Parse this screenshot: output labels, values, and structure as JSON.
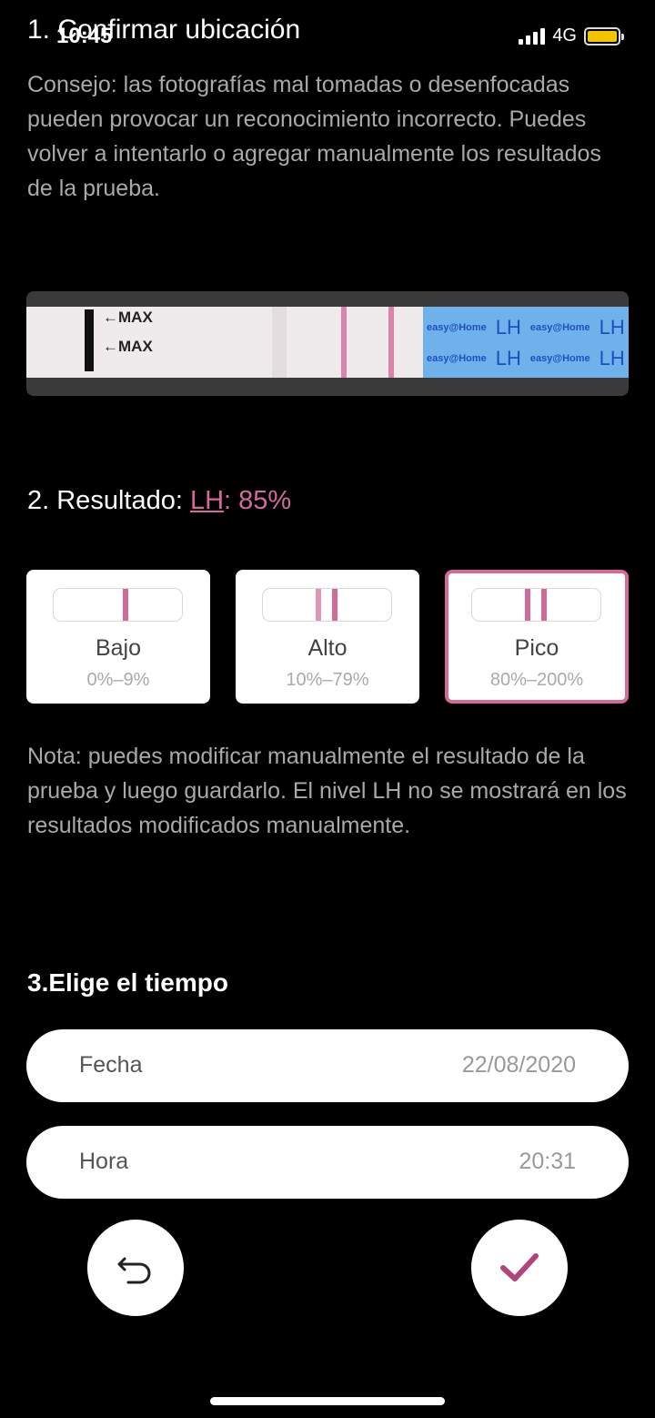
{
  "status_bar": {
    "time": "10:45",
    "network": "4G"
  },
  "section1": {
    "title": "1. Confirmar ubicación",
    "tip": "Consejo: las fotografías mal tomadas o desenfocadas pueden provocar un reconocimiento incorrecto. Puedes volver a intentarlo o agregar manualmente los resultados de la prueba."
  },
  "strip": {
    "max_label_1": "←MAX",
    "max_label_2": "←MAX",
    "brand_text": "easy@Home",
    "lh_text": "LH"
  },
  "section2": {
    "title_prefix": "2. Resultado: ",
    "lh_link": "LH",
    "value": ": 85%",
    "options": [
      {
        "label": "Bajo",
        "range": "0%–9%"
      },
      {
        "label": "Alto",
        "range": "10%–79%"
      },
      {
        "label": "Pico",
        "range": "80%–200%",
        "selected": true
      }
    ],
    "note": "Nota: puedes modificar manualmente el resultado de la prueba y luego guardarlo. El nivel LH no se mostrará en los resultados modificados manualmente."
  },
  "section3": {
    "title": "3.Elige el tiempo",
    "date_label": "Fecha",
    "date_value": "22/08/2020",
    "time_label": "Hora",
    "time_value": "20:31"
  },
  "colors": {
    "accent": "#d46a9a",
    "background": "#000000"
  }
}
